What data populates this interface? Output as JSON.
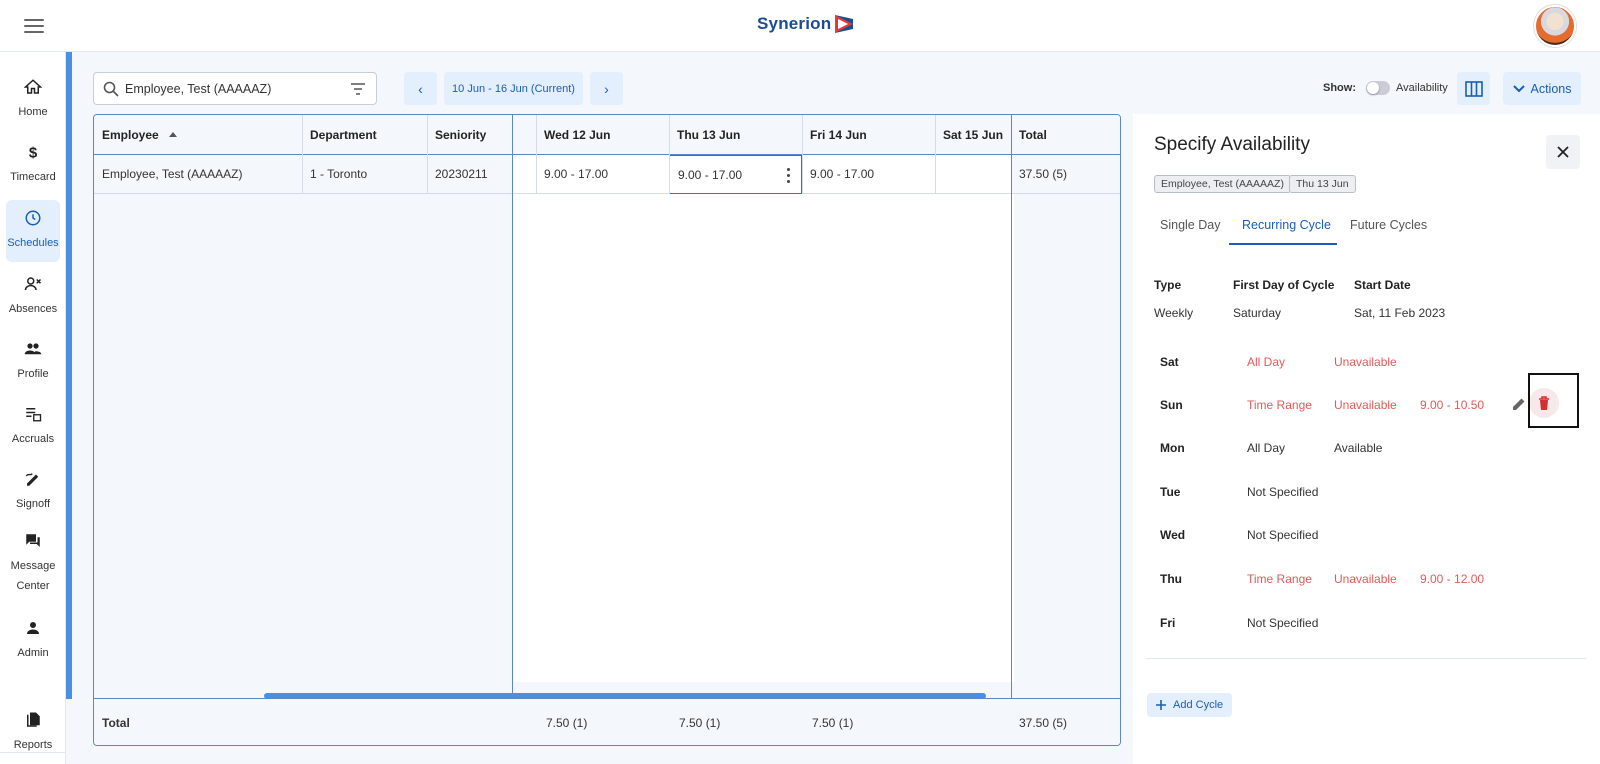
{
  "app": {
    "logo_text": "Synerion"
  },
  "nav": {
    "items": [
      {
        "label": "Home",
        "icon": "home-icon"
      },
      {
        "label": "Timecard",
        "icon": "dollar-icon"
      },
      {
        "label": "Schedules",
        "icon": "clock-icon",
        "active": true
      },
      {
        "label": "Absences",
        "icon": "person-remove-icon"
      },
      {
        "label": "Profile",
        "icon": "people-icon"
      },
      {
        "label": "Accruals",
        "icon": "list-calendar-icon"
      },
      {
        "label": "Signoff",
        "icon": "signature-icon"
      },
      {
        "label": "Message Center",
        "icon": "forum-icon"
      },
      {
        "label": "Admin",
        "icon": "person-icon"
      },
      {
        "label": "Reports",
        "icon": "documents-icon"
      }
    ]
  },
  "toolbar": {
    "search_value": "Employee, Test (AAAAAZ)",
    "date_range": "10 Jun - 16 Jun (Current)",
    "show_label": "Show:",
    "availability_label": "Availability",
    "availability_on": false,
    "actions_label": "Actions"
  },
  "grid": {
    "headers": {
      "employee": "Employee",
      "department": "Department",
      "seniority": "Seniority",
      "wed": "Wed 12 Jun",
      "thu": "Thu 13 Jun",
      "fri": "Fri 14 Jun",
      "sat": "Sat 15 Jun",
      "total": "Total"
    },
    "row": {
      "employee": "Employee, Test (AAAAAZ)",
      "department": "1 - Toronto",
      "seniority": "20230211",
      "wed": "9.00 - 17.00",
      "thu": "9.00 - 17.00",
      "fri": "9.00 - 17.00",
      "sat": "",
      "total": "37.50 (5)"
    },
    "totals": {
      "label": "Total",
      "wed": "7.50 (1)",
      "thu": "7.50 (1)",
      "fri": "7.50 (1)",
      "total": "37.50 (5)"
    }
  },
  "panel": {
    "title": "Specify Availability",
    "chips": [
      "Employee, Test (AAAAAZ)",
      "Thu 13 Jun"
    ],
    "tabs": [
      "Single Day",
      "Recurring Cycle",
      "Future Cycles"
    ],
    "active_tab": "Recurring Cycle",
    "meta": {
      "type_label": "Type",
      "type_value": "Weekly",
      "first_day_label": "First Day of Cycle",
      "first_day_value": "Saturday",
      "start_label": "Start Date",
      "start_value": "Sat, 11 Feb 2023"
    },
    "days": [
      {
        "day": "Sat",
        "mode": "All Day",
        "status": "Unavailable",
        "range": ""
      },
      {
        "day": "Sun",
        "mode": "Time Range",
        "status": "Unavailable",
        "range": "9.00 - 10.50"
      },
      {
        "day": "Mon",
        "mode": "All Day",
        "status": "Available",
        "range": ""
      },
      {
        "day": "Tue",
        "mode": "Not Specified",
        "status": "",
        "range": ""
      },
      {
        "day": "Wed",
        "mode": "Not Specified",
        "status": "",
        "range": ""
      },
      {
        "day": "Thu",
        "mode": "Time Range",
        "status": "Unavailable",
        "range": "9.00 - 12.00"
      },
      {
        "day": "Fri",
        "mode": "Not Specified",
        "status": "",
        "range": ""
      }
    ],
    "add_cycle_label": "Add Cycle"
  },
  "colors": {
    "accent": "#1b5eb5",
    "unavailable": "#e05a5a",
    "delete": "#d32f2f"
  }
}
